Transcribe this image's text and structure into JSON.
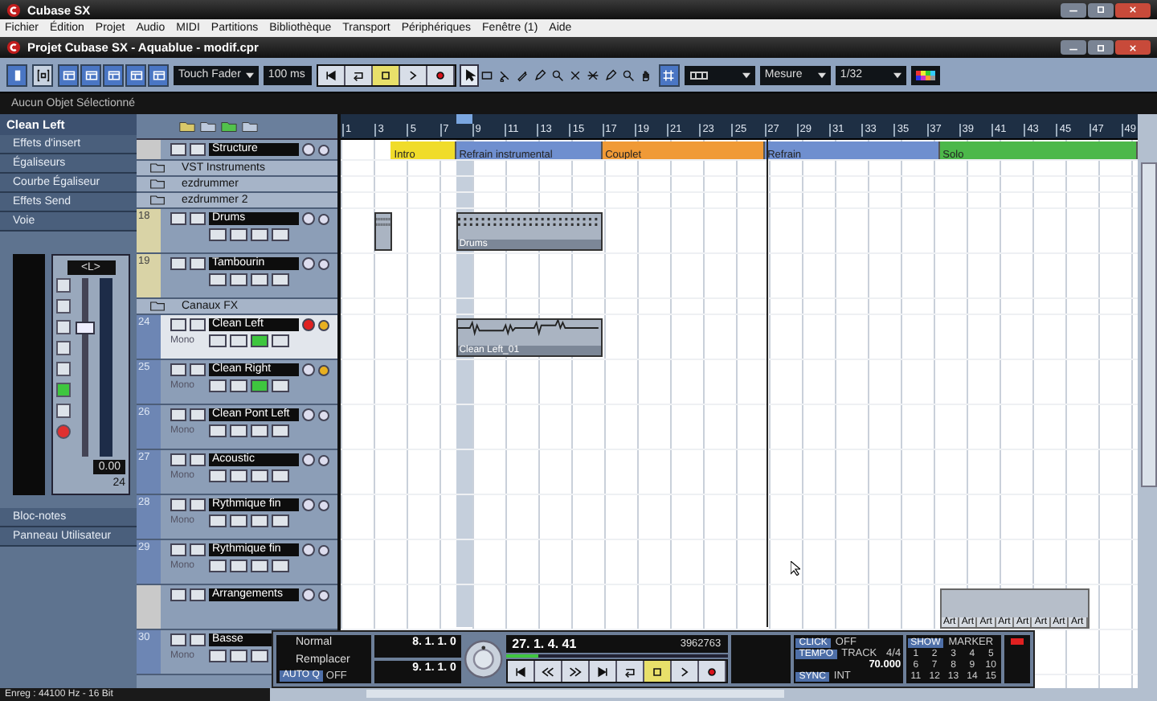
{
  "window": {
    "title": "Cubase SX"
  },
  "menu": [
    "Fichier",
    "Édition",
    "Projet",
    "Audio",
    "MIDI",
    "Partitions",
    "Bibliothèque",
    "Transport",
    "Périphériques",
    "Fenêtre (1)",
    "Aide"
  ],
  "project_window": {
    "title": "Projet Cubase SX - Aquablue - modif.cpr"
  },
  "toolbar": {
    "automation_mode": "Touch Fader",
    "time": "100 ms",
    "snap_type": "Mesure",
    "quantize": "1/32",
    "transport_buttons": [
      {
        "kind": "to-start",
        "on": false
      },
      {
        "kind": "cycle",
        "on": false
      },
      {
        "kind": "stop",
        "on": true
      },
      {
        "kind": "play",
        "on": false
      },
      {
        "kind": "record",
        "on": false
      }
    ],
    "tools": [
      {
        "kind": "arrow",
        "selected": true
      },
      {
        "kind": "range",
        "selected": false
      },
      {
        "kind": "split",
        "selected": false
      },
      {
        "kind": "glue",
        "selected": false
      },
      {
        "kind": "draw",
        "selected": false
      },
      {
        "kind": "zoom",
        "selected": false
      },
      {
        "kind": "erase",
        "selected": false
      },
      {
        "kind": "mute",
        "selected": false
      },
      {
        "kind": "draw",
        "selected": false
      },
      {
        "kind": "zoom",
        "selected": false
      },
      {
        "kind": "hand",
        "selected": false
      }
    ]
  },
  "info_line": "Aucun Objet Sélectionné",
  "inspector": {
    "track_name": "Clean Left",
    "sections": [
      "Effets d'insert",
      "Égaliseurs",
      "Courbe Égaliseur",
      "Effets Send",
      "Voie"
    ],
    "channel": {
      "pan": "<L>",
      "volume": "0.00",
      "number": "24",
      "level": 0.72
    },
    "bottom_sections": [
      "Bloc-notes",
      "Panneau Utilisateur"
    ]
  },
  "ruler": [
    "1",
    "3",
    "5",
    "7",
    "9",
    "11",
    "13",
    "15",
    "17",
    "19",
    "21",
    "23",
    "25",
    "27",
    "29",
    "31",
    "33",
    "35",
    "37",
    "39",
    "41",
    "43",
    "45",
    "47",
    "49"
  ],
  "tracks": [
    {
      "kind": "structure",
      "name": "Structure",
      "selected": false,
      "segments": [
        {
          "label": "Intro",
          "color": "#f0dc2a"
        },
        {
          "label": "Refrain instrumental",
          "color": "#6f8fcf"
        },
        {
          "label": "Couplet",
          "color": "#f09a36"
        },
        {
          "label": "Refrain",
          "color": "#6f8fcf"
        },
        {
          "label": "Solo",
          "color": "#4cb84a"
        }
      ]
    },
    {
      "kind": "folder",
      "name": "VST Instruments",
      "selected": false
    },
    {
      "kind": "folder",
      "name": "ezdrummer",
      "selected": false
    },
    {
      "kind": "folder",
      "name": "ezdrummer 2",
      "selected": false
    },
    {
      "kind": "instrument",
      "number": "18",
      "name": "Drums",
      "selected": false,
      "record": false,
      "monitor": false,
      "parts": [
        {
          "kind": "midi"
        },
        {
          "kind": "midi",
          "name": "Drums"
        }
      ]
    },
    {
      "kind": "instrument",
      "number": "19",
      "name": "Tambourin",
      "selected": false,
      "record": false,
      "monitor": false
    },
    {
      "kind": "folder",
      "name": "Canaux FX",
      "selected": false
    },
    {
      "kind": "audio",
      "number": "24",
      "name": "Clean Left",
      "mode": "Mono",
      "selected": true,
      "record": true,
      "monitor": true,
      "parts": [
        {
          "kind": "audio",
          "name": "Clean Left_01"
        }
      ]
    },
    {
      "kind": "audio",
      "number": "25",
      "name": "Clean Right",
      "mode": "Mono",
      "selected": false,
      "record": false,
      "monitor": true
    },
    {
      "kind": "audio",
      "number": "26",
      "name": "Clean Pont Left",
      "mode": "Mono",
      "selected": false,
      "record": false,
      "monitor": false
    },
    {
      "kind": "audio",
      "number": "27",
      "name": "Acoustic",
      "mode": "Mono",
      "selected": false,
      "record": false,
      "monitor": false
    },
    {
      "kind": "audio",
      "number": "28",
      "name": "Rythmique fin",
      "mode": "Mono",
      "selected": false,
      "record": false,
      "monitor": false
    },
    {
      "kind": "audio",
      "number": "29",
      "name": "Rythmique fin",
      "mode": "Mono",
      "selected": false,
      "record": false,
      "monitor": false
    },
    {
      "kind": "arranger",
      "name": "Arrangements",
      "selected": false,
      "parts": [
        {
          "kind": "arranger",
          "labels": [
            "Art",
            "Art",
            "Art",
            "Art",
            "Art",
            "Art",
            "Art",
            "Art"
          ]
        }
      ]
    },
    {
      "kind": "audio",
      "number": "30",
      "name": "Basse",
      "mode": "Mono",
      "selected": false
    }
  ],
  "transport": {
    "record_mode": "Normal",
    "cycle_mode": "Remplacer",
    "auto_q": "AUTO Q",
    "auto_q_state": "OFF",
    "left_locator": "8. 1. 1. 0",
    "right_locator": "9. 1. 1. 0",
    "position": "27. 1. 4. 41",
    "samples": "3962763",
    "level": 0.15,
    "buttons": [
      {
        "kind": "to-start",
        "on": false
      },
      {
        "kind": "rewind",
        "on": false
      },
      {
        "kind": "forward",
        "on": false
      },
      {
        "kind": "to-end",
        "on": false
      },
      {
        "kind": "cycle",
        "on": false
      },
      {
        "kind": "stop",
        "on": true
      },
      {
        "kind": "play",
        "on": false
      },
      {
        "kind": "record",
        "on": false
      }
    ],
    "click": "CLICK",
    "click_state": "OFF",
    "tempo": "TEMPO",
    "tempo_mode": "TRACK",
    "signature": "4/4",
    "bpm": "70.000",
    "sync": "SYNC",
    "sync_state": "INT",
    "show": "SHOW",
    "markers_label": "MARKER",
    "markers": [
      "1",
      "2",
      "3",
      "4",
      "5",
      "6",
      "7",
      "8",
      "9",
      "10",
      "11",
      "12",
      "13",
      "14",
      "15"
    ]
  },
  "status": "Enreg : 44100 Hz - 16 Bit"
}
